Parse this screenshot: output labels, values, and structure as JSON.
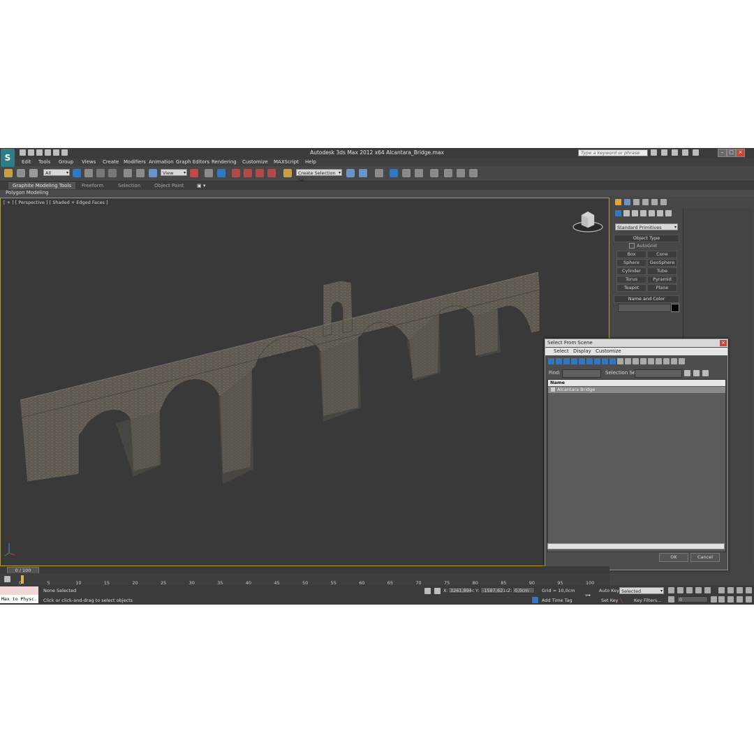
{
  "window": {
    "title": "Autodesk 3ds Max  2012 x64    Alcantara_Bridge.max",
    "search_placeholder": "Type a keyword or phrase",
    "logo_glyph": "S"
  },
  "menu": [
    "Edit",
    "Tools",
    "Group",
    "Views",
    "Create",
    "Modifiers",
    "Animation",
    "Graph Editors",
    "Rendering",
    "Customize",
    "MAXScript",
    "Help"
  ],
  "toolbar": {
    "filter_value": "All",
    "ref_coord_value": "View",
    "selection_set_value": "Create Selection Se"
  },
  "ribbon": {
    "tabs": [
      "Graphite Modeling Tools",
      "Freeform",
      "Selection",
      "Object Paint"
    ],
    "subpanel": "Polygon Modeling"
  },
  "viewport": {
    "label": "[ + ] [ Perspective ] [ Shaded + Edged Faces ]"
  },
  "command_panel": {
    "primitive_type": "Standard Primitives",
    "object_type_header": "Object Type",
    "autogrid_label": "AutoGrid",
    "buttons": [
      "Box",
      "Cone",
      "Sphere",
      "GeoSphere",
      "Cylinder",
      "Tube",
      "Torus",
      "Pyramid",
      "Teapot",
      "Plane"
    ],
    "name_color_header": "Name and Color"
  },
  "dialog": {
    "title": "Select From Scene",
    "menu": [
      "Select",
      "Display",
      "Customize"
    ],
    "find_label": "Find:",
    "selection_set_label": "Selection Set:",
    "column_header": "Name",
    "rows": [
      "Alcantara Bridge"
    ],
    "ok_label": "OK",
    "cancel_label": "Cancel"
  },
  "timeline": {
    "frame_display": "0 / 100",
    "ticks": [
      "0",
      "5",
      "10",
      "15",
      "20",
      "25",
      "30",
      "35",
      "40",
      "45",
      "50",
      "55",
      "60",
      "65",
      "70",
      "75",
      "80",
      "85",
      "90",
      "95",
      "100"
    ]
  },
  "status": {
    "maxscript_text": "Max to Physc.",
    "selection_status": "None Selected",
    "prompt": "Click or click-and-drag to select objects",
    "x_label": "X:",
    "x_value": "3261,894c",
    "y_label": "Y:",
    "y_value": "-1587,621c",
    "z_label": "Z:",
    "z_value": "0,0cm",
    "grid": "Grid = 10,0cm",
    "add_time_tag": "Add Time Tag",
    "auto_key": "Auto Key",
    "auto_key_value": "Selected",
    "set_key": "Set Key",
    "key_filters": "Key Filters...",
    "current_frame": "0"
  },
  "colors": {
    "accent_blue": "#2f78c4",
    "viewport_border": "#b99b3a",
    "bridge": "#5f5a54"
  }
}
